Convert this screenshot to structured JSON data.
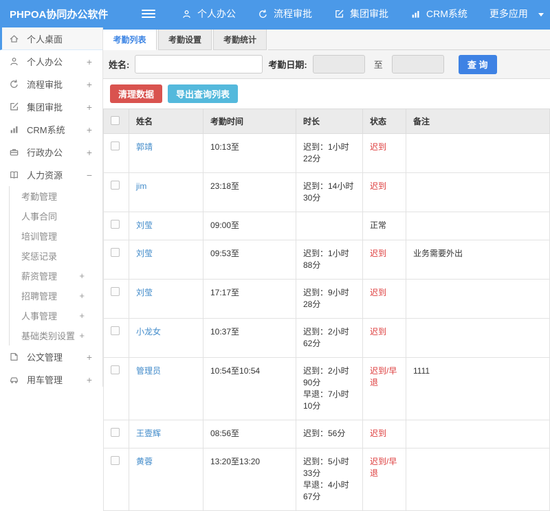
{
  "colors": {
    "header_blue": "#4b99e8",
    "tab_active_blue": "#3d85e4",
    "link_blue": "#428bca",
    "status_red": "#dd3c3c",
    "danger_red": "#d9534f",
    "info_blue": "#54b9dc",
    "primary_blue": "#3e82e4"
  },
  "header": {
    "title": "PHPOA协同办公软件",
    "nav": [
      {
        "label": "个人办公",
        "icon": "person-icon"
      },
      {
        "label": "流程审批",
        "icon": "flow-arrow-icon"
      },
      {
        "label": "集团审批",
        "icon": "edit-icon"
      },
      {
        "label": "CRM系统",
        "icon": "bar-chart-icon"
      },
      {
        "label": "更多应用",
        "icon": "caret-down-icon",
        "caret": true
      }
    ]
  },
  "sidebar": {
    "items": [
      {
        "label": "个人桌面",
        "icon": "home-icon",
        "active": true,
        "expand": ""
      },
      {
        "label": "个人办公",
        "icon": "person-icon",
        "expand": "+"
      },
      {
        "label": "流程审批",
        "icon": "flow-arrow-icon",
        "expand": "+"
      },
      {
        "label": "集团审批",
        "icon": "edit-icon",
        "expand": "+"
      },
      {
        "label": "CRM系统",
        "icon": "bar-chart-icon",
        "expand": "+"
      },
      {
        "label": "行政办公",
        "icon": "briefcase-icon",
        "expand": "+"
      },
      {
        "label": "人力资源",
        "icon": "book-icon",
        "expand": "−"
      }
    ],
    "submenu": [
      {
        "label": "考勤管理",
        "expand": ""
      },
      {
        "label": "人事合同",
        "expand": ""
      },
      {
        "label": "培训管理",
        "expand": ""
      },
      {
        "label": "奖惩记录",
        "expand": ""
      },
      {
        "label": "薪资管理",
        "expand": "+"
      },
      {
        "label": "招聘管理",
        "expand": "+"
      },
      {
        "label": "人事管理",
        "expand": "+"
      },
      {
        "label": "基础类别设置",
        "expand": "+"
      }
    ],
    "bottom_items": [
      {
        "label": "公文管理",
        "icon": "document-icon",
        "expand": "+"
      },
      {
        "label": "用车管理",
        "icon": "car-icon",
        "expand": "+"
      }
    ]
  },
  "tabs": [
    {
      "label": "考勤列表",
      "active": true
    },
    {
      "label": "考勤设置",
      "active": false
    },
    {
      "label": "考勤统计",
      "active": false
    }
  ],
  "filter": {
    "name_label": "姓名:",
    "name_value": "",
    "date_label": "考勤日期:",
    "date_from": "",
    "to_label": "至",
    "date_to": "",
    "search_button": "查 询"
  },
  "actions": {
    "clean_button": "清理数据",
    "export_button": "导出查询列表"
  },
  "table": {
    "headers": [
      "姓名",
      "考勤时间",
      "时长",
      "状态",
      "备注"
    ],
    "rows": [
      {
        "name": "郭靖",
        "time": "10:13至",
        "durations": [
          "迟到：1小时22分"
        ],
        "status": "迟到",
        "status_red": true,
        "note": ""
      },
      {
        "name": "jim",
        "time": "23:18至",
        "durations": [
          "迟到：14小时30分"
        ],
        "status": "迟到",
        "status_red": true,
        "note": ""
      },
      {
        "name": "刘莹",
        "time": "09:00至",
        "durations": [],
        "status": "正常",
        "status_red": false,
        "note": ""
      },
      {
        "name": "刘莹",
        "time": "09:53至",
        "durations": [
          "迟到：1小时88分"
        ],
        "status": "迟到",
        "status_red": true,
        "note": "业务需要外出"
      },
      {
        "name": "刘莹",
        "time": "17:17至",
        "durations": [
          "迟到：9小时28分"
        ],
        "status": "迟到",
        "status_red": true,
        "note": ""
      },
      {
        "name": "小龙女",
        "time": "10:37至",
        "durations": [
          "迟到：2小时62分"
        ],
        "status": "迟到",
        "status_red": true,
        "note": ""
      },
      {
        "name": "管理员",
        "time": "10:54至10:54",
        "durations": [
          "迟到：2小时90分",
          "早退：7小时10分"
        ],
        "status": "迟到/早退",
        "status_red": true,
        "note": "1111"
      },
      {
        "name": "王壹辉",
        "time": "08:56至",
        "durations": [
          "迟到：56分"
        ],
        "status": "迟到",
        "status_red": true,
        "note": ""
      },
      {
        "name": "黄蓉",
        "time": "13:20至13:20",
        "durations": [
          "迟到：5小时33分",
          "早退：4小时67分"
        ],
        "status": "迟到/早退",
        "status_red": true,
        "note": ""
      }
    ]
  }
}
